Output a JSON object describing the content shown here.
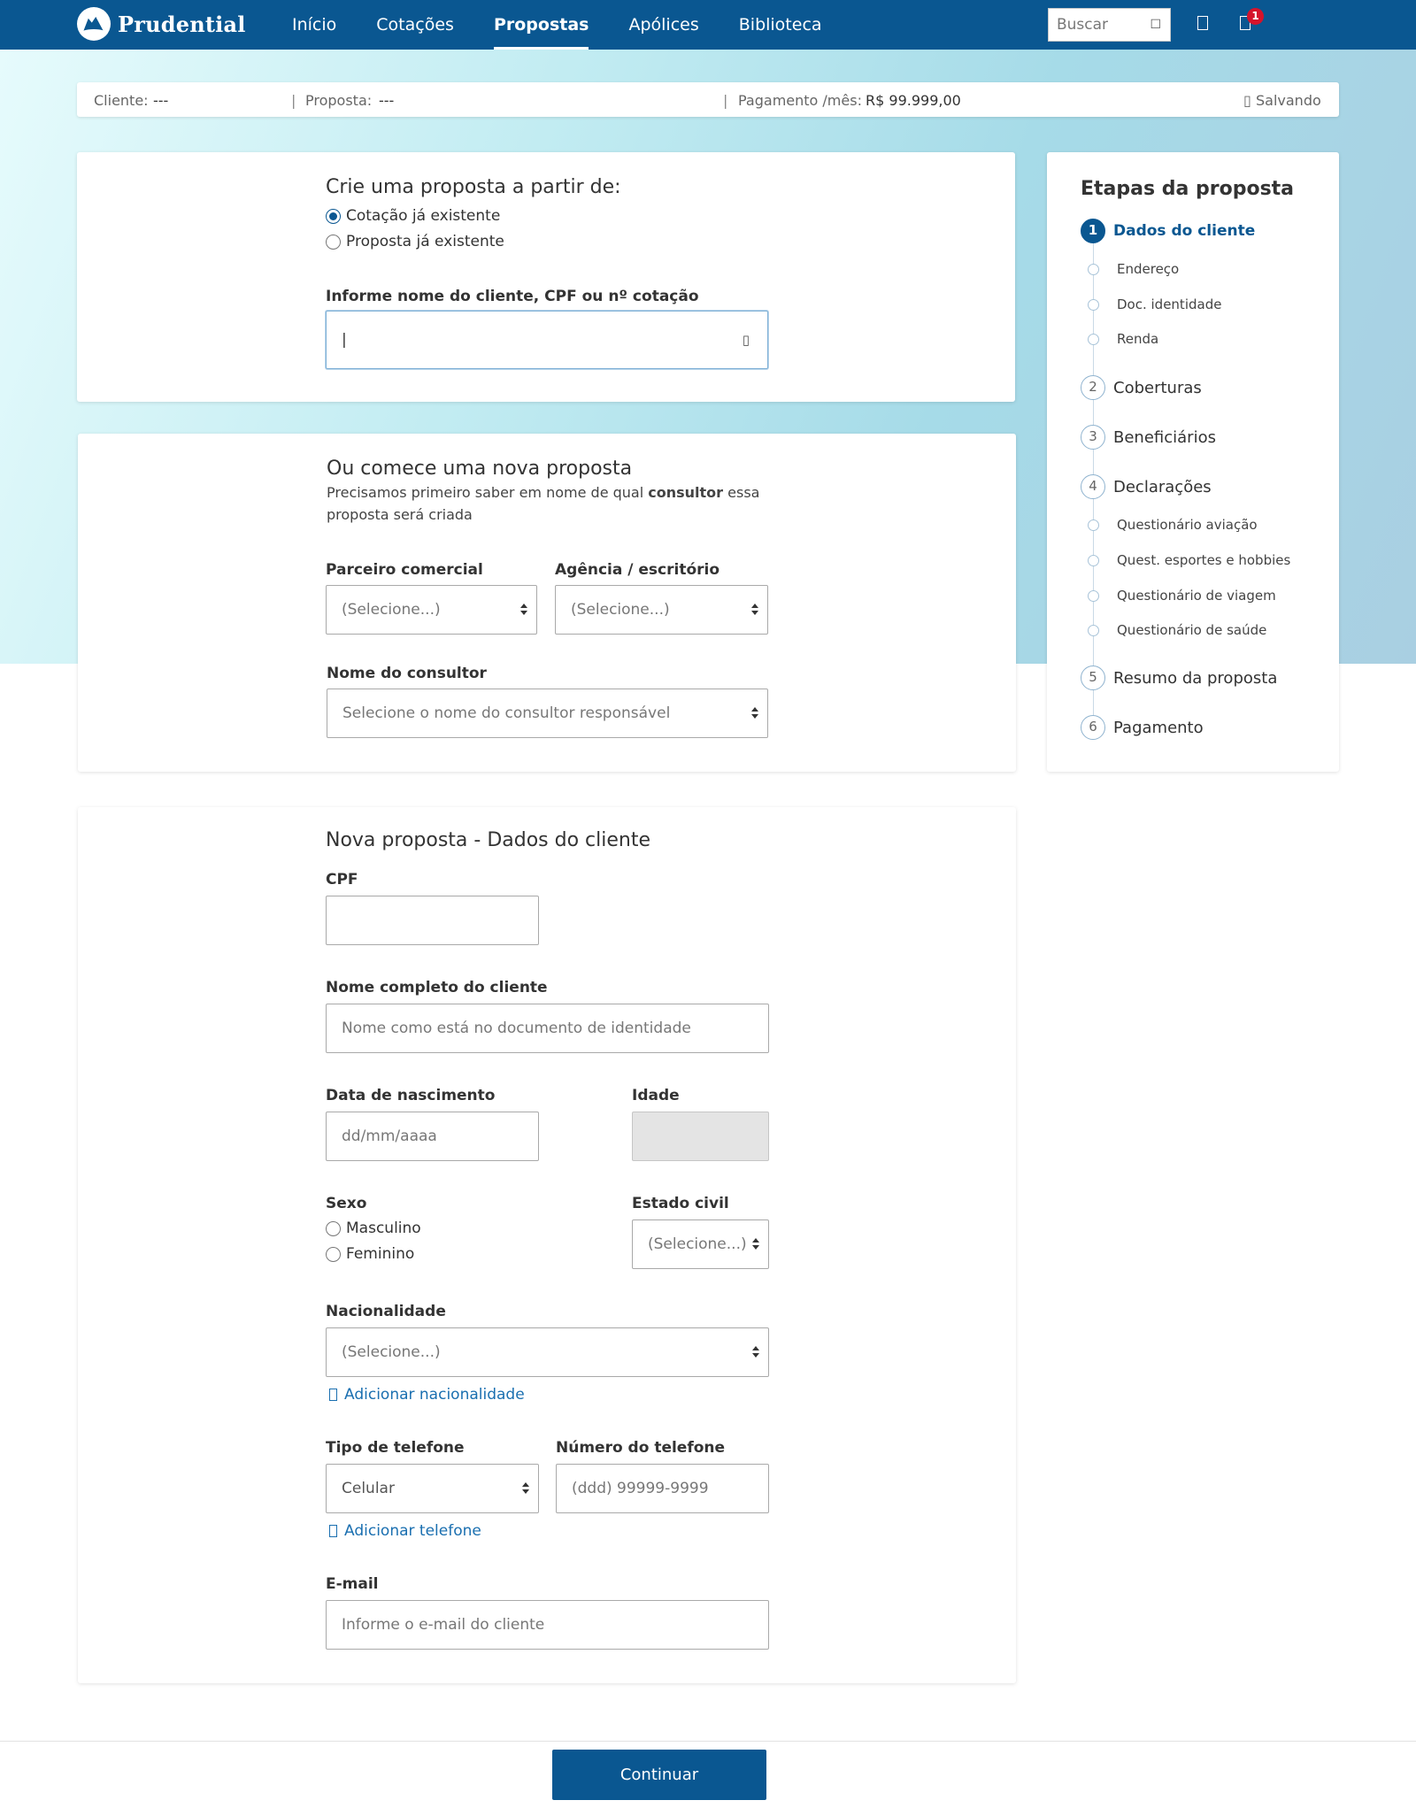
{
  "nav": {
    "brand": "Prudential",
    "links": [
      "Início",
      "Cotações",
      "Propostas",
      "Apólices",
      "Biblioteca"
    ],
    "active": "Propostas",
    "search_placeholder": "Buscar",
    "notifications_count": "1",
    "icons": [
      "search-icon",
      "user-icon",
      "bell-icon"
    ]
  },
  "infobar": {
    "cliente_label": "Cliente:",
    "cliente_value": "---",
    "proposta_label": "Proposta:",
    "proposta_value": "---",
    "pagamento_label": "Pagamento /mês:",
    "pagamento_value": "R$ 99.999,00",
    "status": "Salvando"
  },
  "create_from": {
    "title": "Crie uma proposta a partir de:",
    "options": [
      "Cotação já existente",
      "Proposta já existente"
    ],
    "selected": "Cotação já existente",
    "search_label": "Informe nome do cliente, CPF ou nº cotação",
    "search_value": "|"
  },
  "new_proposal": {
    "title": "Ou comece uma nova proposta",
    "desc_before": "Precisamos primeiro saber em nome de qual ",
    "desc_bold": "consultor",
    "desc_after": " essa",
    "desc_line2": "proposta será criada",
    "parceiro_label": "Parceiro comercial",
    "parceiro_value": "(Selecione...)",
    "agencia_label": "Agência / escritório",
    "agencia_value": "(Selecione...)",
    "consultor_label": "Nome do consultor",
    "consultor_value": "Selecione o nome do consultor responsável"
  },
  "client_data": {
    "title": "Nova proposta - Dados do cliente",
    "cpf_label": "CPF",
    "cpf_value": "",
    "nome_label": "Nome completo do cliente",
    "nome_placeholder": "Nome como está no documento de identidade",
    "nasc_label": "Data de nascimento",
    "nasc_placeholder": "dd/mm/aaaa",
    "idade_label": "Idade",
    "sexo_label": "Sexo",
    "sexo_options": [
      "Masculino",
      "Feminino"
    ],
    "estado_civil_label": "Estado civil",
    "estado_civil_value": "(Selecione...)",
    "nacionalidade_label": "Nacionalidade",
    "nacionalidade_value": "(Selecione...)",
    "add_nacionalidade": "Adicionar nacionalidade",
    "tipo_tel_label": "Tipo de telefone",
    "tipo_tel_value": "Celular",
    "num_tel_label": "Número do telefone",
    "num_tel_placeholder": "(ddd) 99999-9999",
    "add_telefone": "Adicionar telefone",
    "email_label": "E-mail",
    "email_placeholder": "Informe o e-mail do cliente"
  },
  "steps": {
    "title": "Etapas da proposta",
    "items": [
      {
        "num": "1",
        "label": "Dados do cliente",
        "active": true,
        "subs": [
          "Endereço",
          "Doc. identidade",
          "Renda"
        ]
      },
      {
        "num": "2",
        "label": "Coberturas"
      },
      {
        "num": "3",
        "label": "Beneficiários"
      },
      {
        "num": "4",
        "label": "Declarações",
        "subs": [
          "Questionário aviação",
          "Quest. esportes e hobbies",
          "Questionário de viagem",
          "Questionário de saúde"
        ]
      },
      {
        "num": "5",
        "label": "Resumo da proposta"
      },
      {
        "num": "6",
        "label": "Pagamento"
      }
    ]
  },
  "footer": {
    "continue_label": "Continuar"
  },
  "colors": {
    "primary": "#0a5791",
    "badge": "#d5132b",
    "link": "#1a6fb0"
  }
}
